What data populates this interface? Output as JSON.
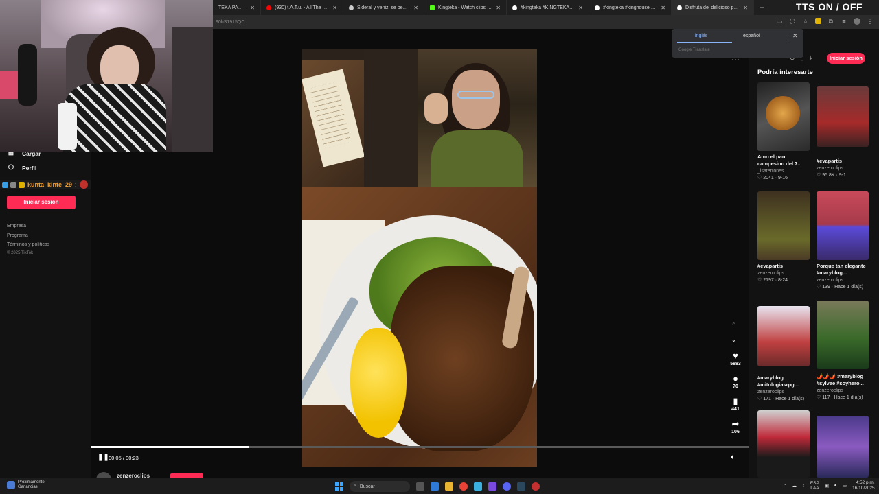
{
  "browser": {
    "tabs": [
      {
        "title": "TEKA PARCH4 A",
        "color": "#888888",
        "active": false
      },
      {
        "title": "(930) t.A.T.u. - All The Things S",
        "color": "#ff0000",
        "active": false
      },
      {
        "title": "Sideral y yeniz, se besan. #zull",
        "color": "#cccccc",
        "active": false
      },
      {
        "title": "Kingteka - Watch clips on Kick",
        "color": "#53fc18",
        "active": false
      },
      {
        "title": "#kingteka #KINGTEKA #faraon",
        "color": "#ffffff",
        "active": false
      },
      {
        "title": "#kingteka #kinghouse #KINGTE",
        "color": "#ffffff",
        "active": false
      },
      {
        "title": "Disfruta del delicioso pan d",
        "color": "#ffffff",
        "active": true
      }
    ],
    "new_tab": "+",
    "url": "90bS1915QC",
    "overlay_label": "TTS ON / OFF"
  },
  "translate_popup": {
    "lang_from": "inglés",
    "lang_to": "español",
    "brand": "Google Translate"
  },
  "sidebar": {
    "items": [
      {
        "label": "Cargar",
        "icon": "upload-icon"
      },
      {
        "label": "Perfil",
        "icon": "profile-icon"
      }
    ],
    "login_label": "Iniciar sesión",
    "footer_links": [
      "Empresa",
      "Programa",
      "Términos y políticas"
    ],
    "copyright": "© 2025 TikTok"
  },
  "chat": {
    "username": "kunta_kinte_29",
    "separator": ":"
  },
  "video": {
    "likes": "5883",
    "comments": "70",
    "saves": "441",
    "shares": "106",
    "time": "00:05 / 00:23",
    "progress_fraction": 0.24,
    "author": "zenzeroclips"
  },
  "header": {
    "login_label": "Iniciar sesión"
  },
  "recommendations": {
    "title": "Podría interesarte",
    "items": [
      {
        "title_line1": "Amo el pan",
        "title_line2": "campesino del 7...",
        "author": "_isaterrones",
        "meta": "♡ 2041 · 9-16"
      },
      {
        "title_line1": "#evapartis",
        "title_line2": "",
        "author": "zenzeroclips",
        "meta": "♡ 95.8K · 9-1"
      },
      {
        "title_line1": "#evapartis",
        "title_line2": "",
        "author": "zenzeroclips",
        "meta": "♡ 2197 · 8-24"
      },
      {
        "title_line1": "Porque tan elegante",
        "title_line2": "#maryblog...",
        "author": "zenzeroclips",
        "meta": "♡ 139 · Hace 1 día(s)"
      },
      {
        "title_line1": "#maryblog",
        "title_line2": "#mitologiasrpg...",
        "author": "zenzeroclips",
        "meta": "♡ 171 · Hace 1 día(s)"
      },
      {
        "title_line1": "🌶️🌶️🌶️ #maryblog",
        "title_line2": "#sylvee #soyhero...",
        "author": "zenzeroclips",
        "meta": "♡ 117 · Hace 1 día(s)"
      }
    ]
  },
  "taskbar": {
    "widget_line1": "Próximamente",
    "widget_line2": "Ganancias",
    "search_label": "Buscar",
    "lang_line1": "ESP",
    "lang_line2": "LAA",
    "time": "4:52 p.m.",
    "date": "16/10/2025"
  }
}
